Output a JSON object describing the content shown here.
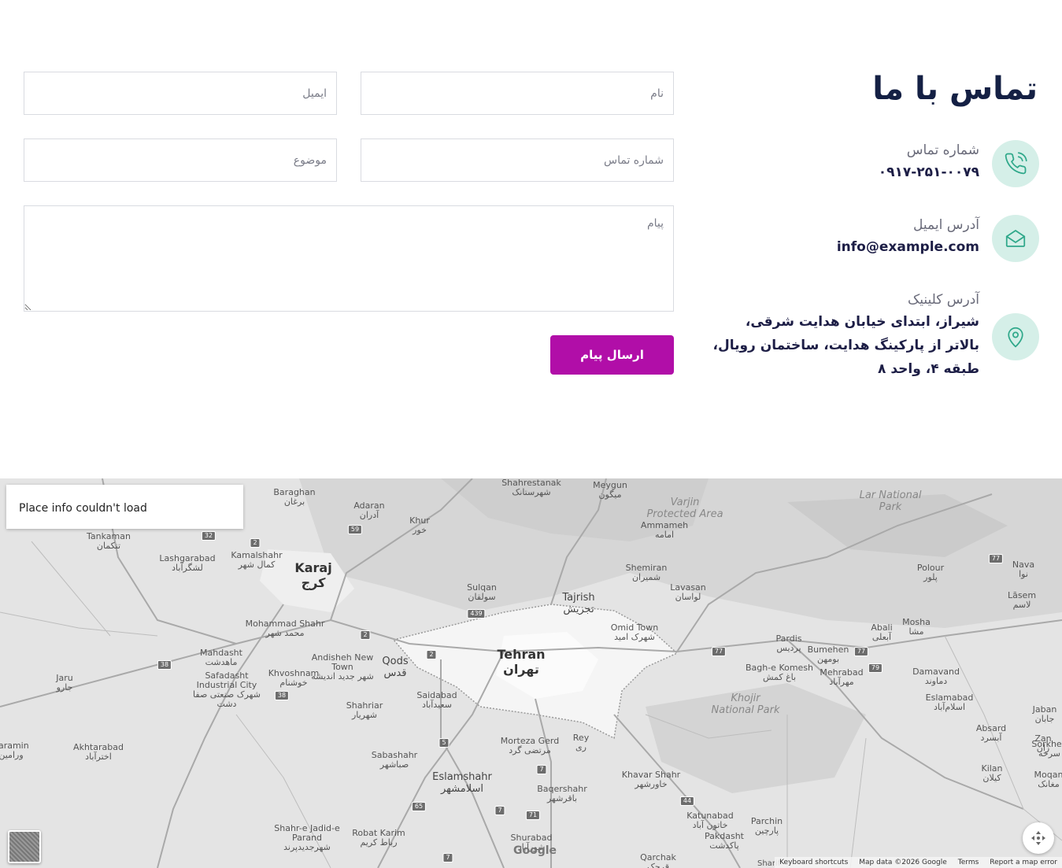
{
  "contact": {
    "title": "تماس با ما",
    "phone_label": "شماره تماس",
    "phone_value": "۰۹۱۷-۲۵۱-۰۰۷۹",
    "email_label": "آدرس ایمیل",
    "email_value": "info@example.com",
    "address_label": "آدرس کلینیک",
    "address_value": "شیراز، ابتدای خیابان هدایت شرقی، بالاتر از پارکینگ هدایت، ساختمان رویال، طبقه ۴، واحد ۸",
    "icons": {
      "phone": "phone-icon",
      "email": "envelope-open-icon",
      "address": "map-pin-icon"
    },
    "accent_bg": "#d5efe8",
    "accent_icon": "#2fa88a"
  },
  "form": {
    "name_placeholder": "نام",
    "email_placeholder": "ایمیل",
    "phone_placeholder": "شماره تماس",
    "subject_placeholder": "موضوع",
    "message_placeholder": "پیام",
    "submit_label": "ارسال پیام",
    "submit_color": "#b10ea8"
  },
  "map": {
    "place_card_text": "Place info couldn't load",
    "google_logo": "Google",
    "attribution": {
      "keyboard": "Keyboard shortcuts",
      "data": "Map data ©2026 Google",
      "terms": "Terms",
      "report": "Report a map error"
    },
    "sharif_label": "Sharif",
    "places": [
      {
        "en": "Shahrestanak",
        "fa": "شهرستانک"
      },
      {
        "en": "Meygun",
        "fa": "میگون"
      },
      {
        "en": "Varjin",
        "fa": "Protected Area"
      },
      {
        "en": "Lar National",
        "fa": "Park"
      },
      {
        "en": "Baraghan",
        "fa": "برغان"
      },
      {
        "en": "Adaran",
        "fa": "آدران"
      },
      {
        "en": "Khur",
        "fa": "خور"
      },
      {
        "en": "Ammameh",
        "fa": "امامه"
      },
      {
        "en": "Tankaman",
        "fa": "تنکمان"
      },
      {
        "en": "Lashgarabad",
        "fa": "لشگرآباد"
      },
      {
        "en": "Kamalshahr",
        "fa": "کمال شهر"
      },
      {
        "en": "Karaj",
        "fa": "کرج"
      },
      {
        "en": "Shemiran",
        "fa": "شمیران"
      },
      {
        "en": "Polour",
        "fa": "پلور"
      },
      {
        "en": "Nava",
        "fa": "نوا"
      },
      {
        "en": "Sulqan",
        "fa": "سولقان"
      },
      {
        "en": "Tajrish",
        "fa": "تجریش"
      },
      {
        "en": "Lavasan",
        "fa": "لواسان"
      },
      {
        "en": "Lāsem",
        "fa": "لاسم"
      },
      {
        "en": "Mohammad Shahr",
        "fa": "محمد شهر"
      },
      {
        "en": "Omid Town",
        "fa": "شهرک امید"
      },
      {
        "en": "Mosha",
        "fa": "مشا"
      },
      {
        "en": "Abali",
        "fa": "آبعلی"
      },
      {
        "en": "Mahdasht",
        "fa": "ماهدشت"
      },
      {
        "en": "Andisheh New Town",
        "fa": "شهر جدید اندیشه"
      },
      {
        "en": "Qods",
        "fa": "قدس"
      },
      {
        "en": "Tehran",
        "fa": "تهران"
      },
      {
        "en": "Pardis",
        "fa": "پردیس"
      },
      {
        "en": "Bumehen",
        "fa": "بومهن"
      },
      {
        "en": "Jaru",
        "fa": "جارو"
      },
      {
        "en": "Safadasht Industrial City",
        "fa": "شهرک صنعتی صفا دشت"
      },
      {
        "en": "Khvoshnam",
        "fa": "خوشنام"
      },
      {
        "en": "Bagh-e Komesh",
        "fa": "باغ کمش"
      },
      {
        "en": "Mehrabad",
        "fa": "مهرآباد"
      },
      {
        "en": "Damavand",
        "fa": "دماوند"
      },
      {
        "en": "Shahriar",
        "fa": "شهریار"
      },
      {
        "en": "Saidabad",
        "fa": "سعیدآباد"
      },
      {
        "en": "Khojir",
        "fa": "National Park"
      },
      {
        "en": "Eslamabad",
        "fa": "اسلام‌آباد"
      },
      {
        "en": "Jaban",
        "fa": "جابان"
      },
      {
        "en": "Akhtarabad",
        "fa": "اخترآباد"
      },
      {
        "en": "Varamin",
        "fa": "ورامین"
      },
      {
        "en": "Morteza Gerd",
        "fa": "مرتضی گرد"
      },
      {
        "en": "Rey",
        "fa": "ری"
      },
      {
        "en": "Absard",
        "fa": "آبسرد"
      },
      {
        "en": "Zan",
        "fa": "زان"
      },
      {
        "en": "Sorkheh",
        "fa": "سرخه"
      },
      {
        "en": "Sabashahr",
        "fa": "صباشهر"
      },
      {
        "en": "Eslamshahr",
        "fa": "اسلامشهر"
      },
      {
        "en": "Khavar Shahr",
        "fa": "خاورشهر"
      },
      {
        "en": "Kilan",
        "fa": "کیلان"
      },
      {
        "en": "Moqan",
        "fa": "مغانک"
      },
      {
        "en": "Baqershahr",
        "fa": "باقرشهر"
      },
      {
        "en": "Katunabad",
        "fa": "خاتون آباد"
      },
      {
        "en": "Parchin",
        "fa": "پارچین"
      },
      {
        "en": "Pakdasht",
        "fa": "پاکدشت"
      },
      {
        "en": "Shahr-e Jadid-e Parand",
        "fa": "شهرجدیدپرند"
      },
      {
        "en": "Robat Karim",
        "fa": "رباط کریم"
      },
      {
        "en": "Shurabad",
        "fa": "شورآباد"
      },
      {
        "en": "Qarchak",
        "fa": "قرچک"
      }
    ],
    "shields": [
      "32",
      "2",
      "59",
      "439",
      "2",
      "2",
      "38",
      "38",
      "77",
      "77",
      "77",
      "79",
      "5",
      "7",
      "65",
      "7",
      "71",
      "44",
      "7"
    ]
  }
}
